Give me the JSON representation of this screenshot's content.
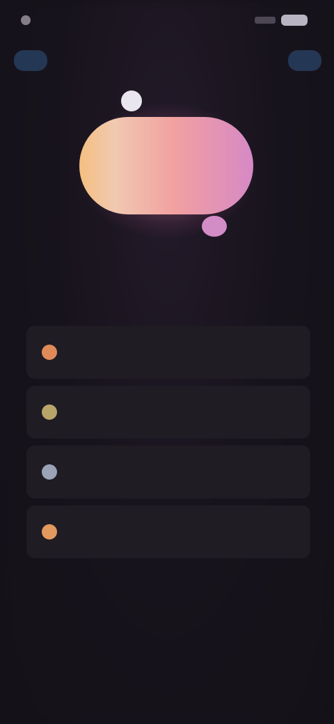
{
  "status_bar": {
    "time": "",
    "battery": ""
  },
  "header": {
    "left_button_label": "",
    "right_button_label": ""
  },
  "hero": {
    "icon": "gift-icon"
  },
  "headline": "",
  "options": [
    {
      "label": "",
      "icon": "sun-icon",
      "accent": "#e08a5a"
    },
    {
      "label": "",
      "icon": "moon-icon",
      "accent": "#b8a56a"
    },
    {
      "label": "",
      "icon": "calendar-icon",
      "accent": "#9aa3b8"
    },
    {
      "label": "",
      "icon": "bell-icon",
      "accent": "#e39a5e"
    }
  ]
}
